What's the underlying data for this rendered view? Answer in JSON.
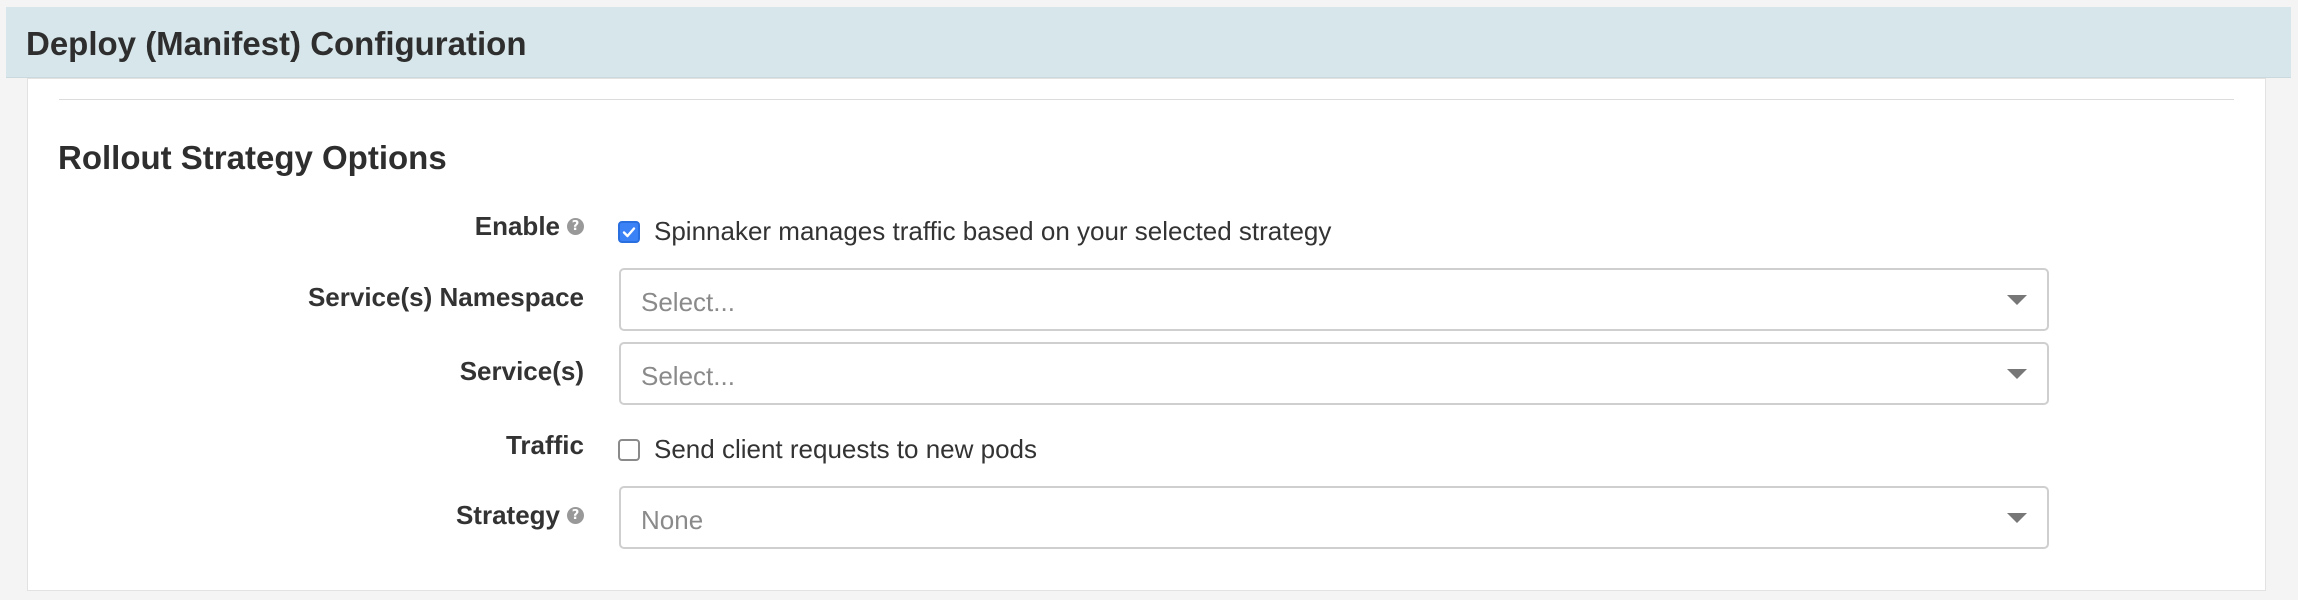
{
  "header": {
    "title": "Deploy (Manifest) Configuration"
  },
  "section": {
    "title": "Rollout Strategy Options"
  },
  "rows": {
    "enable": {
      "label": "Enable",
      "checkbox_label": "Spinnaker manages traffic based on your selected strategy",
      "checked": true
    },
    "namespace": {
      "label": "Service(s) Namespace",
      "placeholder": "Select..."
    },
    "services": {
      "label": "Service(s)",
      "placeholder": "Select..."
    },
    "traffic": {
      "label": "Traffic",
      "checkbox_label": "Send client requests to new pods",
      "checked": false
    },
    "strategy": {
      "label": "Strategy",
      "value": "None"
    }
  },
  "icons": {
    "help": "question-circle-icon",
    "dropdown": "caret-down-icon",
    "check": "checkmark-icon"
  },
  "colors": {
    "header_bg": "#d7e6ea",
    "checkbox_checked": "#3b82f6",
    "placeholder_text": "#8a8a8a"
  }
}
